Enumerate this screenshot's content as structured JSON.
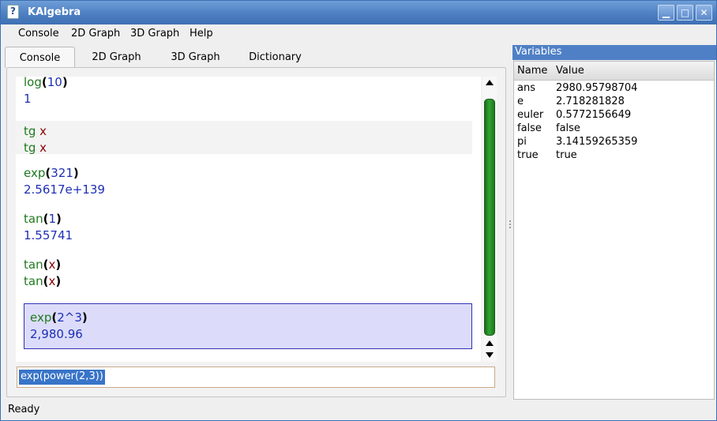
{
  "window": {
    "title": "KAlgebra",
    "controls": {
      "minimize": "▁",
      "maximize": "□",
      "close": "✕"
    }
  },
  "menubar": {
    "items": [
      "Console",
      "2D Graph",
      "3D Graph",
      "Help"
    ]
  },
  "tabs": {
    "items": [
      "Console",
      "2D Graph",
      "3D Graph",
      "Dictionary"
    ],
    "active": "Console"
  },
  "console": {
    "entries": [
      {
        "input": [
          [
            "log",
            "fn"
          ],
          [
            "(",
            "par"
          ],
          [
            "10",
            "num"
          ],
          [
            ")",
            "par"
          ]
        ],
        "output": [
          [
            "1",
            "num"
          ]
        ],
        "style": "normal"
      },
      {
        "input": [
          [
            "tg ",
            "fn"
          ],
          [
            "x",
            "var"
          ]
        ],
        "output": [
          [
            "tg ",
            "fn"
          ],
          [
            "x",
            "var"
          ]
        ],
        "style": "shaded"
      },
      {
        "input": [
          [
            "exp",
            "fn"
          ],
          [
            "(",
            "par"
          ],
          [
            "321",
            "num"
          ],
          [
            ")",
            "par"
          ]
        ],
        "output": [
          [
            "2.5617e+139",
            "num"
          ]
        ],
        "style": "normal"
      },
      {
        "input": [
          [
            "tan",
            "fn"
          ],
          [
            "(",
            "par"
          ],
          [
            "1",
            "num"
          ],
          [
            ")",
            "par"
          ]
        ],
        "output": [
          [
            "1.55741",
            "num"
          ]
        ],
        "style": "normal"
      },
      {
        "input": [
          [
            "tan",
            "fn"
          ],
          [
            "(",
            "par"
          ],
          [
            "x",
            "var"
          ],
          [
            ")",
            "par"
          ]
        ],
        "output": [
          [
            "tan",
            "fn"
          ],
          [
            "(",
            "par"
          ],
          [
            "x",
            "var"
          ],
          [
            ")",
            "par"
          ]
        ],
        "style": "normal"
      },
      {
        "input": [
          [
            "exp",
            "fn"
          ],
          [
            "(",
            "par"
          ],
          [
            "2^3",
            "num"
          ],
          [
            ")",
            "par"
          ]
        ],
        "output": [
          [
            "2,980.96",
            "num"
          ]
        ],
        "style": "selected"
      }
    ],
    "input_value": "exp(power(2,3))"
  },
  "status": {
    "text": "Ready"
  },
  "variables": {
    "title": "Variables",
    "headers": {
      "name": "Name",
      "value": "Value"
    },
    "rows": [
      {
        "name": "ans",
        "value": "2980.95798704"
      },
      {
        "name": "e",
        "value": "2.718281828"
      },
      {
        "name": "euler",
        "value": "0.5772156649"
      },
      {
        "name": "false",
        "value": "false"
      },
      {
        "name": "pi",
        "value": "3.14159265359"
      },
      {
        "name": "true",
        "value": "true"
      }
    ]
  },
  "colors": {
    "function": "#1f7a1f",
    "number": "#1d2fb5",
    "variable": "#8b0000",
    "selection": "#dcdcfa",
    "titlebar": "#4d7fc2",
    "scroll_thumb": "#2fa52f"
  },
  "icons": {
    "app": "kalgebra-icon",
    "scroll_up": "arrow-up-icon",
    "scroll_down": "arrow-down-icon"
  }
}
